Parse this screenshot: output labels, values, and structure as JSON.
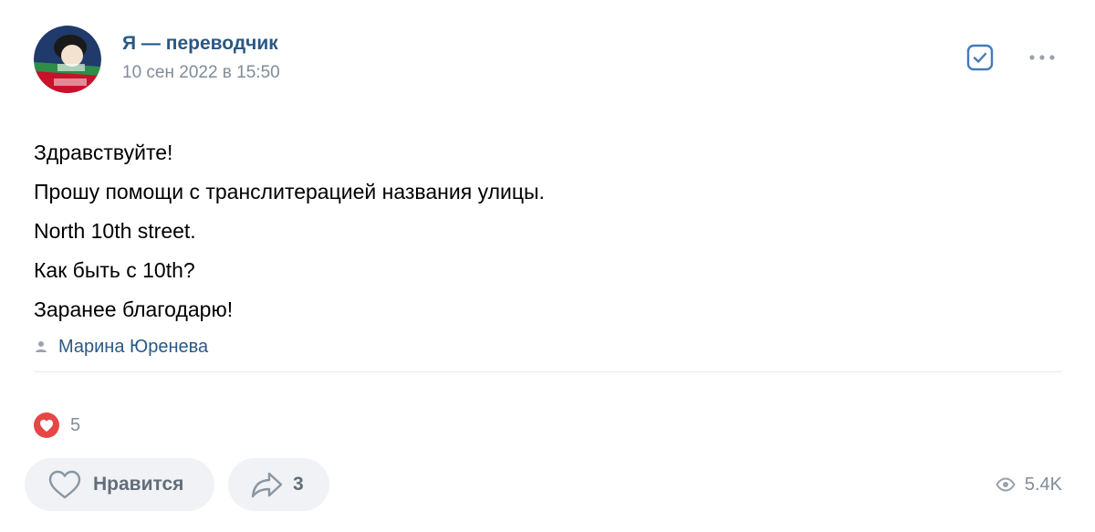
{
  "header": {
    "author_name": "Я — переводчик",
    "date": "10 сен 2022 в 15:50",
    "avatar_icon": "community-avatar-icon",
    "actions": [
      {
        "icon": "checkbox-checked-icon"
      },
      {
        "icon": "more-horizontal-icon"
      }
    ]
  },
  "post": {
    "lines": [
      "Здравствуйте!",
      "Прошу помощи с транслитерацией названия улицы.",
      "North 10th street.",
      "Как быть с 10th?",
      "Заранее благодарю!"
    ],
    "signer": {
      "icon": "user-icon",
      "name": "Марина Юренева"
    }
  },
  "reactions": {
    "icon": "heart-reaction-icon",
    "count": "5"
  },
  "footer": {
    "like_label": "Нравится",
    "like_icon": "heart-outline-icon",
    "share_icon": "share-arrow-icon",
    "share_count": "3",
    "view_icon": "eye-icon",
    "views": "5.4K"
  },
  "colors": {
    "link": "#2a5885",
    "secondary_text": "#818c99",
    "button_bg": "#f0f2f5",
    "button_text": "#626d7a",
    "accent": "#447bba",
    "reaction_red": "#e64646",
    "divider": "#e7e8ec"
  }
}
